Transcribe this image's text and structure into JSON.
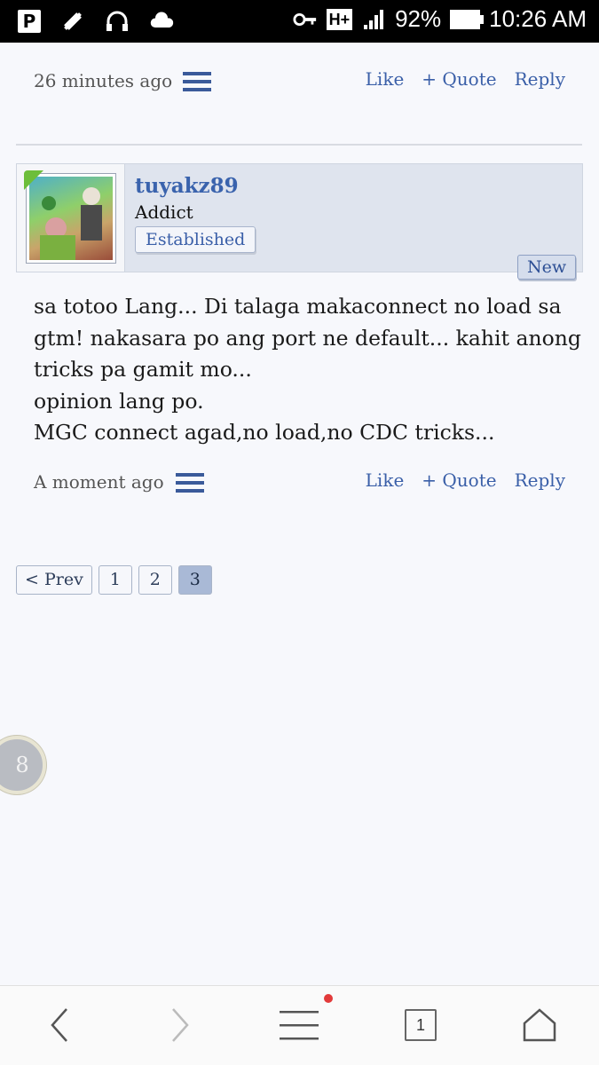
{
  "status_bar": {
    "p_label": "P",
    "hplus": "H+",
    "battery_pct": "92%",
    "time": "10:26 AM",
    "icons": [
      "p-notification-icon",
      "satellite-icon",
      "headphones-icon",
      "cloud-icon",
      "vpn-key-icon",
      "signal-icon",
      "battery-icon"
    ]
  },
  "prev_post": {
    "time": "26 minutes ago",
    "like": "Like",
    "quote": "+ Quote",
    "reply": "Reply"
  },
  "post": {
    "username": "tuyakz89",
    "user_title": "Addict",
    "badge": "Established",
    "new_label": "New",
    "message_lines": [
      "sa totoo Lang... Di talaga makaconnect no load sa",
      "gtm! nakasara po ang port ne default... kahit anong",
      "tricks pa gamit mo...",
      "opinion lang po.",
      "MGC connect agad,no load,no CDC tricks..."
    ],
    "time": "A moment ago",
    "like": "Like",
    "quote": "+ Quote",
    "reply": "Reply"
  },
  "pagination": {
    "prev": "< Prev",
    "pages": [
      "1",
      "2",
      "3"
    ],
    "current": "3"
  },
  "floating_button": {
    "label": "8"
  },
  "bottom_nav": {
    "tab_count": "1"
  },
  "colors": {
    "link": "#3a5fa8",
    "user_block": "#dfe4ee",
    "active_page": "#a9b9d6",
    "notification_dot": "#e23a3a"
  }
}
